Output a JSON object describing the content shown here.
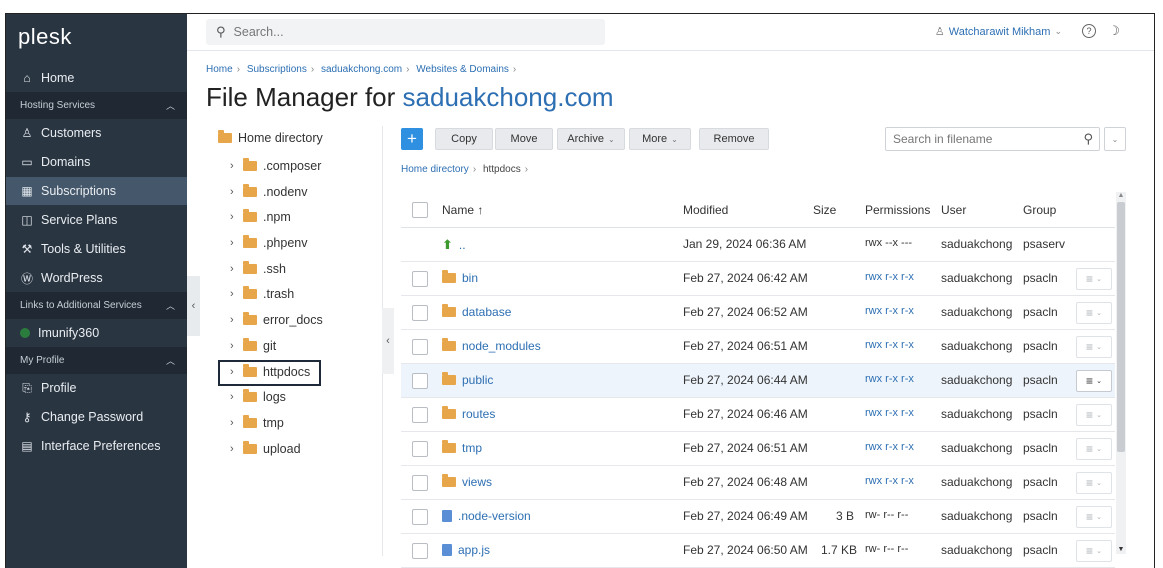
{
  "sidebar": {
    "logo": "plesk",
    "home": "Home",
    "sections": {
      "hosting": "Hosting Services",
      "links": "Links to Additional Services",
      "profile": "My Profile"
    },
    "items": {
      "customers": "Customers",
      "domains": "Domains",
      "subscriptions": "Subscriptions",
      "service_plans": "Service Plans",
      "tools": "Tools & Utilities",
      "wordpress": "WordPress",
      "imunify": "Imunify360",
      "profile": "Profile",
      "change_password": "Change Password",
      "interface_prefs": "Interface Preferences"
    }
  },
  "topbar": {
    "search_placeholder": "Search...",
    "user_name": "Watcharawit Mikham"
  },
  "breadcrumb": [
    "Home",
    "Subscriptions",
    "saduakchong.com",
    "Websites & Domains"
  ],
  "title": {
    "prefix": "File Manager for",
    "domain": "saduakchong.com"
  },
  "tree": {
    "root": "Home directory",
    "items": [
      ".composer",
      ".nodenv",
      ".npm",
      ".phpenv",
      ".ssh",
      ".trash",
      "error_docs",
      "git",
      "httpdocs",
      "logs",
      "tmp",
      "upload"
    ],
    "selected": "httpdocs"
  },
  "toolbar": {
    "add": "+",
    "copy": "Copy",
    "move": "Move",
    "archive": "Archive",
    "more": "More",
    "remove": "Remove",
    "search_placeholder": "Search in filename"
  },
  "path": {
    "root": "Home directory",
    "current": "httpdocs"
  },
  "table": {
    "columns": {
      "name": "Name ↑",
      "modified": "Modified",
      "size": "Size",
      "permissions": "Permissions",
      "user": "User",
      "group": "Group"
    },
    "rows": [
      {
        "name": "..",
        "type": "up",
        "modified": "Jan 29, 2024 06:36 AM",
        "size": "",
        "perms": "rwx --x ---",
        "user": "saduakchong",
        "group": "psaserv"
      },
      {
        "name": "bin",
        "type": "folder",
        "modified": "Feb 27, 2024 06:42 AM",
        "size": "",
        "perms": "rwx r-x r-x",
        "user": "saduakchong",
        "group": "psacln"
      },
      {
        "name": "database",
        "type": "folder",
        "modified": "Feb 27, 2024 06:52 AM",
        "size": "",
        "perms": "rwx r-x r-x",
        "user": "saduakchong",
        "group": "psacln"
      },
      {
        "name": "node_modules",
        "type": "folder",
        "modified": "Feb 27, 2024 06:51 AM",
        "size": "",
        "perms": "rwx r-x r-x",
        "user": "saduakchong",
        "group": "psacln"
      },
      {
        "name": "public",
        "type": "folder",
        "modified": "Feb 27, 2024 06:44 AM",
        "size": "",
        "perms": "rwx r-x r-x",
        "user": "saduakchong",
        "group": "psacln"
      },
      {
        "name": "routes",
        "type": "folder",
        "modified": "Feb 27, 2024 06:46 AM",
        "size": "",
        "perms": "rwx r-x r-x",
        "user": "saduakchong",
        "group": "psacln"
      },
      {
        "name": "tmp",
        "type": "folder",
        "modified": "Feb 27, 2024 06:51 AM",
        "size": "",
        "perms": "rwx r-x r-x",
        "user": "saduakchong",
        "group": "psacln"
      },
      {
        "name": "views",
        "type": "folder",
        "modified": "Feb 27, 2024 06:48 AM",
        "size": "",
        "perms": "rwx r-x r-x",
        "user": "saduakchong",
        "group": "psacln"
      },
      {
        "name": ".node-version",
        "type": "file",
        "modified": "Feb 27, 2024 06:49 AM",
        "size": "3 B",
        "perms": "rw- r-- r--",
        "user": "saduakchong",
        "group": "psacln"
      },
      {
        "name": "app.js",
        "type": "file",
        "modified": "Feb 27, 2024 06:50 AM",
        "size": "1.7 KB",
        "perms": "rw- r-- r--",
        "user": "saduakchong",
        "group": "psacln"
      }
    ]
  },
  "colors": {
    "sidebar_bg": "#2a3542",
    "accent": "#2d6fb3",
    "folder": "#e8a64a",
    "add_button": "#2f8fe0"
  }
}
